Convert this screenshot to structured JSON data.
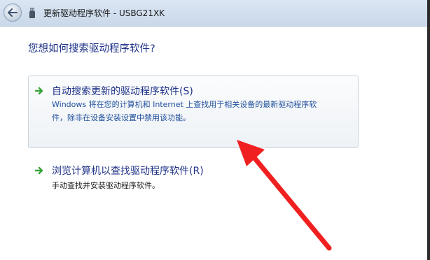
{
  "window": {
    "title": "更新驱动程序软件 - USBG21XK"
  },
  "main": {
    "question": "您想如何搜索驱动程序软件?"
  },
  "options": [
    {
      "title": "自动搜索更新的驱动程序软件(S)",
      "description_lines": [
        "Windows 将在您的计算机和 Internet 上查找用于相关设备的最新驱动程序软",
        "件，除非在设备安装设置中禁用该功能。"
      ]
    },
    {
      "title": "浏览计算机以查找驱动程序软件(R)",
      "description_lines": [
        "手动查找并安装驱动程序软件。"
      ]
    }
  ],
  "icons": {
    "back": "back-arrow-icon",
    "device": "usb-device-icon",
    "option_arrow": "green-arrow-icon"
  },
  "colors": {
    "link_blue": "#1e3287",
    "desc_blue": "#1e4e9c",
    "option_arrow_green": "#3aa43a",
    "annotation_red": "#f02020"
  }
}
